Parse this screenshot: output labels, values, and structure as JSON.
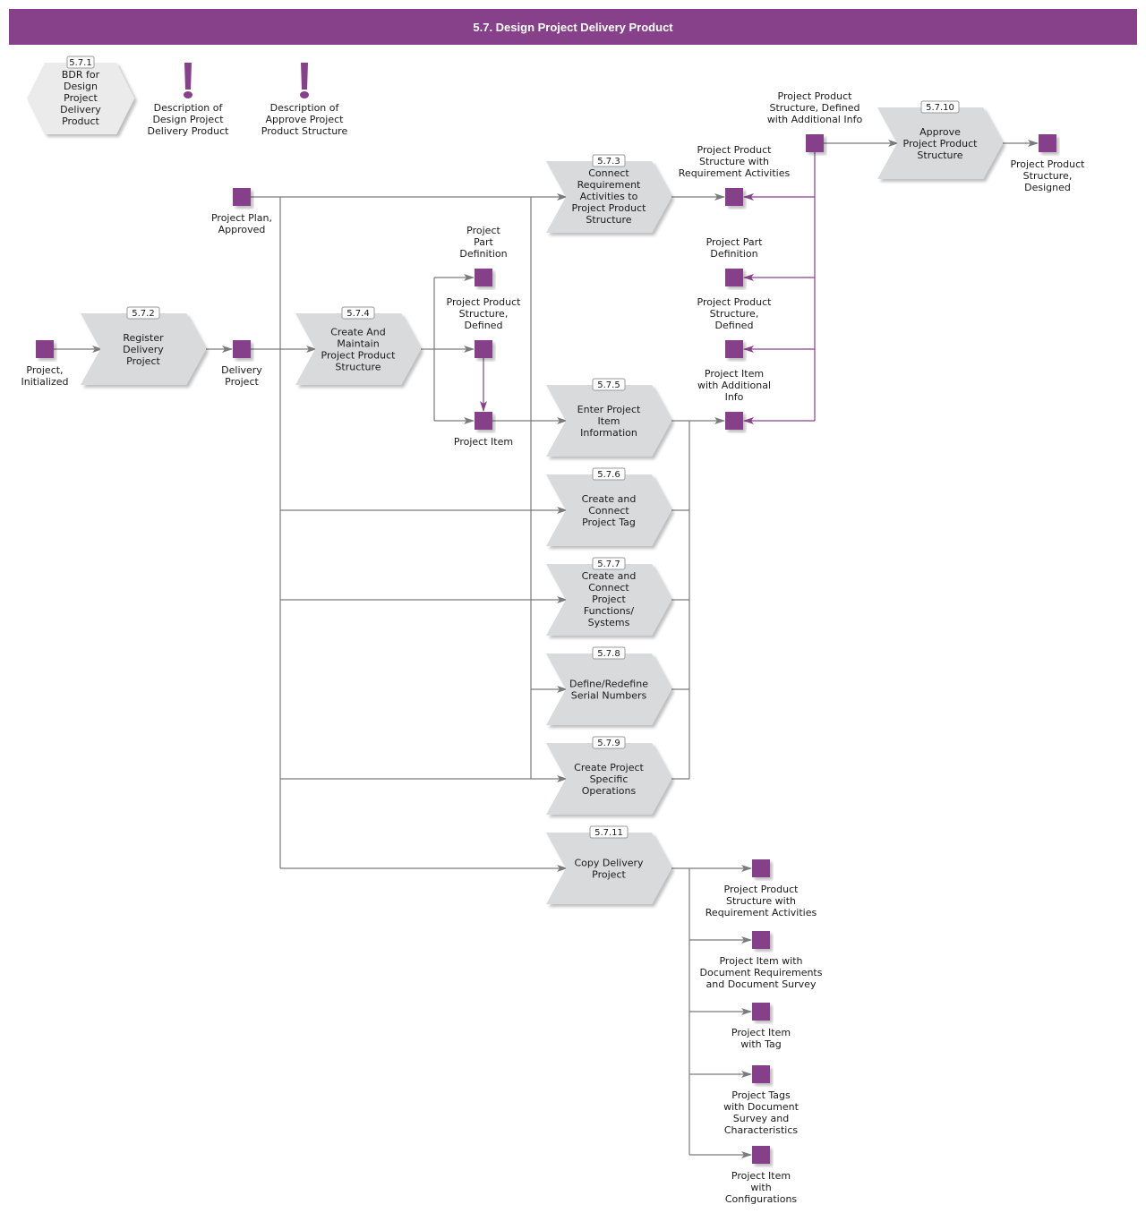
{
  "title": "5.7. Design Project Delivery Product",
  "colors": {
    "accent": "#86418a",
    "process_fill": "#d9dadc",
    "hexagon_fill": "#ebebeb",
    "connector": "#7a7a7a",
    "connector_accent": "#86418a"
  },
  "legend": {
    "bdr": {
      "id": "5.7.1",
      "label": [
        "BDR for",
        "Design",
        "Project",
        "Delivery",
        "Product"
      ]
    },
    "descriptions": [
      {
        "icon": "exclamation-icon",
        "label": [
          "Description of",
          "Design Project",
          "Delivery Product"
        ]
      },
      {
        "icon": "exclamation-icon",
        "label": [
          "Description of",
          "Approve Project",
          "Product Structure"
        ]
      }
    ]
  },
  "processes": [
    {
      "key": "p572",
      "id": "5.7.2",
      "label": [
        "Register",
        "Delivery",
        "Project"
      ]
    },
    {
      "key": "p573",
      "id": "5.7.3",
      "label": [
        "Connect",
        "Requirement",
        "Activities to",
        "Project Product",
        "Structure"
      ]
    },
    {
      "key": "p574",
      "id": "5.7.4",
      "label": [
        "Create And",
        "Maintain",
        "Project Product",
        "Structure"
      ]
    },
    {
      "key": "p575",
      "id": "5.7.5",
      "label": [
        "Enter Project",
        "Item",
        "Information"
      ]
    },
    {
      "key": "p576",
      "id": "5.7.6",
      "label": [
        "Create and",
        "Connect",
        "Project Tag"
      ]
    },
    {
      "key": "p577",
      "id": "5.7.7",
      "label": [
        "Create and",
        "Connect",
        "Project",
        "Functions/",
        "Systems"
      ]
    },
    {
      "key": "p578",
      "id": "5.7.8",
      "label": [
        "Define/Redefine",
        "Serial Numbers"
      ]
    },
    {
      "key": "p579",
      "id": "5.7.9",
      "label": [
        "Create Project",
        "Specific",
        "Operations"
      ]
    },
    {
      "key": "p5710",
      "id": "5.7.10",
      "label": [
        "Approve",
        "Project Product",
        "Structure"
      ]
    },
    {
      "key": "p5711",
      "id": "5.7.11",
      "label": [
        "Copy Delivery",
        "Project"
      ]
    }
  ],
  "objects": [
    {
      "key": "o_proj_init",
      "label": [
        "Project,",
        "Initialized"
      ]
    },
    {
      "key": "o_plan",
      "label": [
        "Project Plan,",
        "Approved"
      ]
    },
    {
      "key": "o_delivery",
      "label": [
        "Delivery",
        "Project"
      ]
    },
    {
      "key": "o_part_def1",
      "label": [
        "Project",
        "Part",
        "Definition"
      ]
    },
    {
      "key": "o_pps_def1",
      "label": [
        "Project Product",
        "Structure,",
        "Defined"
      ]
    },
    {
      "key": "o_item",
      "label": [
        "Project Item"
      ]
    },
    {
      "key": "o_pps_req",
      "label": [
        "Project Product",
        "Structure with",
        "Requirement Activities"
      ]
    },
    {
      "key": "o_part_def2",
      "label": [
        "Project Part",
        "Definition"
      ]
    },
    {
      "key": "o_pps_def2",
      "label": [
        "Project Product",
        "Structure,",
        "Defined"
      ]
    },
    {
      "key": "o_item_add",
      "label": [
        "Project Item",
        "with Additional",
        "Info"
      ]
    },
    {
      "key": "o_pps_add",
      "label": [
        "Project Product",
        "Structure, Defined",
        "with Additional Info"
      ]
    },
    {
      "key": "o_pps_designed",
      "label": [
        "Project Product",
        "Structure,",
        "Designed"
      ]
    },
    {
      "key": "o_copy_pps_req",
      "label": [
        "Project Product",
        "Structure with",
        "Requirement Activities"
      ]
    },
    {
      "key": "o_copy_item_doc",
      "label": [
        "Project Item with",
        "Document Requirements",
        "and Document Survey"
      ]
    },
    {
      "key": "o_copy_item_tag",
      "label": [
        "Project Item",
        "with Tag"
      ]
    },
    {
      "key": "o_copy_tags_doc",
      "label": [
        "Project Tags",
        "with  Document",
        "Survey and",
        "Characteristics"
      ]
    },
    {
      "key": "o_copy_item_conf",
      "label": [
        "Project Item",
        "with",
        "Configurations"
      ]
    }
  ]
}
